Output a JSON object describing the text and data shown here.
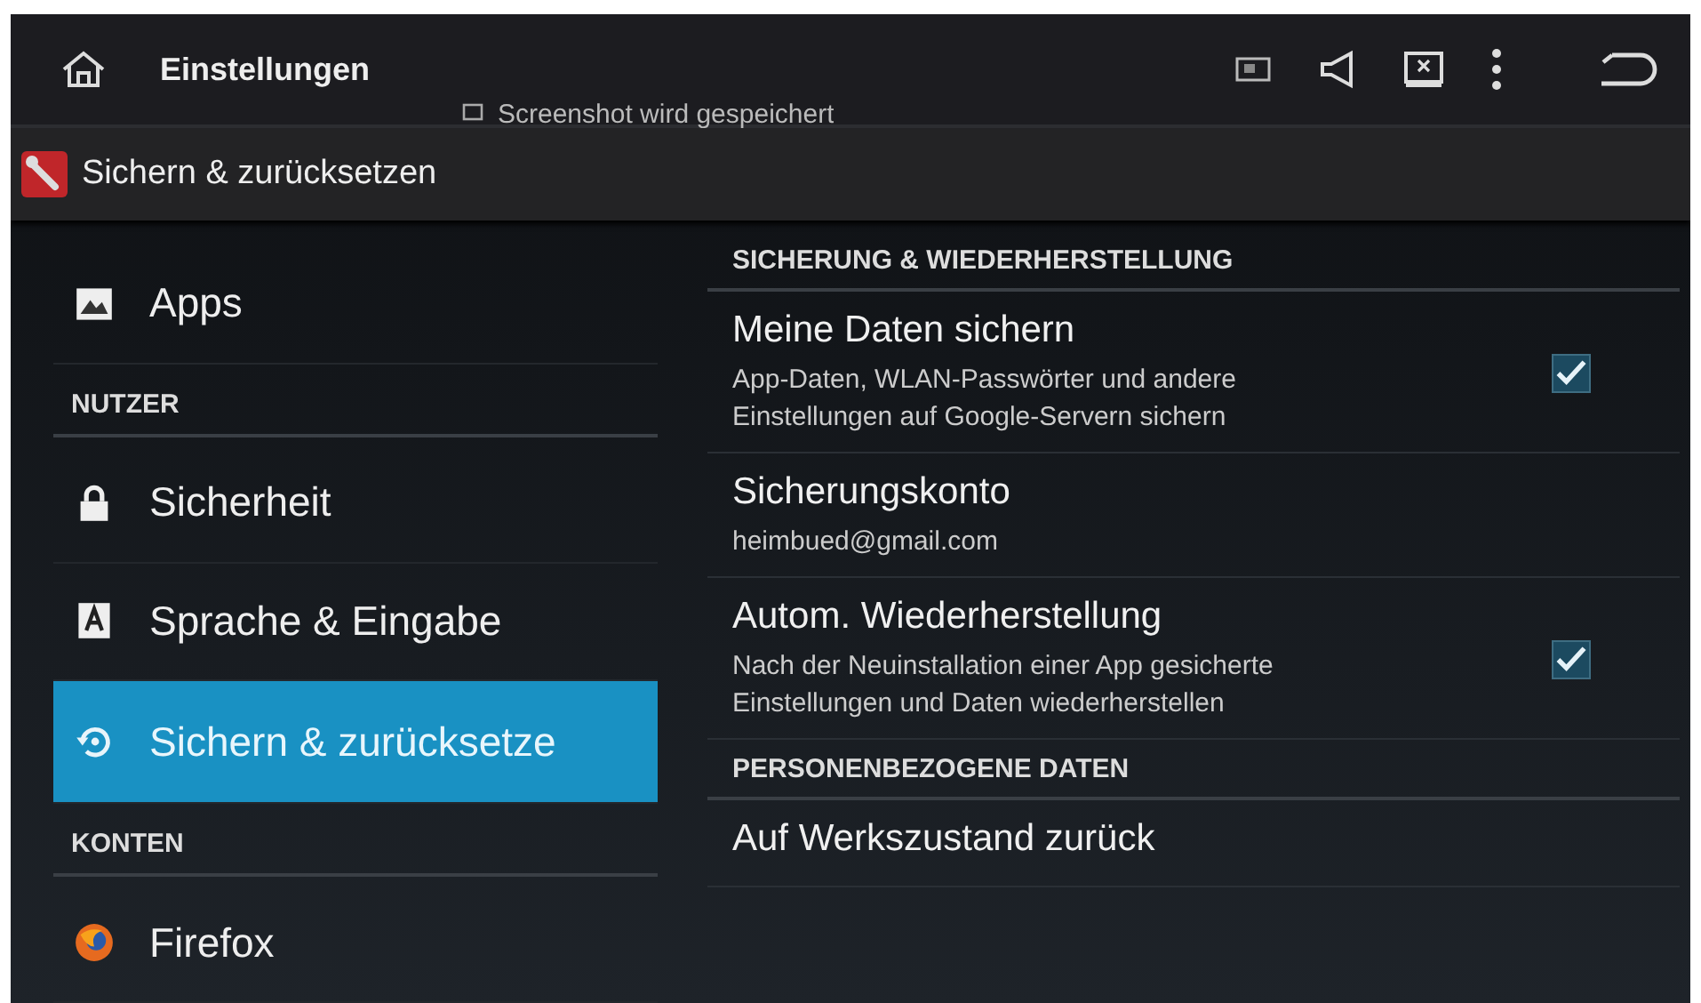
{
  "action_bar": {
    "title": "Einstellungen"
  },
  "notification": {
    "text": "Screenshot wird gespeichert"
  },
  "section_bar": {
    "title": "Sichern & zurücksetzen"
  },
  "sidebar": {
    "items": [
      {
        "kind": "item",
        "label": "Apps",
        "selected": false
      },
      {
        "kind": "header",
        "label": "NUTZER"
      },
      {
        "kind": "item",
        "label": "Sicherheit",
        "selected": false
      },
      {
        "kind": "item",
        "label": "Sprache & Eingabe",
        "selected": false
      },
      {
        "kind": "item",
        "label": "Sichern & zurücksetze",
        "selected": true
      },
      {
        "kind": "header",
        "label": "KONTEN"
      },
      {
        "kind": "item",
        "label": "Firefox",
        "selected": false
      }
    ]
  },
  "settings": [
    {
      "kind": "header",
      "title": "SICHERUNG & WIEDERHERSTELLUNG"
    },
    {
      "kind": "check",
      "title": "Meine Daten sichern",
      "summary": "App-Daten, WLAN-Passwörter und andere Einstellungen auf Google-Servern sichern",
      "checked": true
    },
    {
      "kind": "item",
      "title": "Sicherungskonto",
      "summary": "heimbued@gmail.com"
    },
    {
      "kind": "check",
      "title": "Autom. Wiederherstellung",
      "summary": "Nach der Neuinstallation einer App gesicherte Einstellungen und Daten wiederherstellen",
      "checked": true
    },
    {
      "kind": "header",
      "title": "PERSONENBEZOGENE DATEN"
    },
    {
      "kind": "item",
      "title": "Auf Werkszustand zurück"
    }
  ]
}
